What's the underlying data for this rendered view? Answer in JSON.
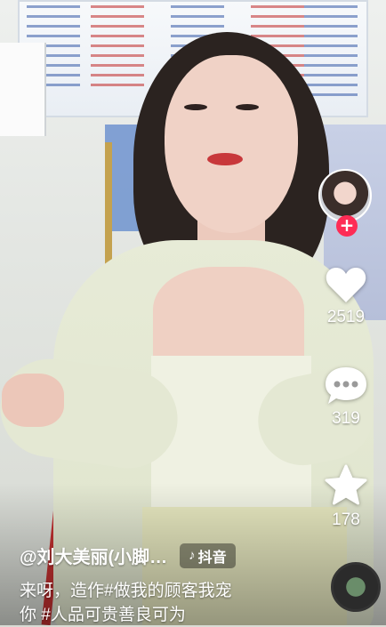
{
  "author": {
    "handle": "@刘大美丽(小脚…"
  },
  "app_badge": {
    "label": "抖音",
    "icon": "music-note-icon"
  },
  "caption": {
    "line1": "来呀，造作#做我的顾客我宠",
    "line2": "你 #人品可贵善良可为"
  },
  "actions": {
    "follow": {
      "symbol": "+",
      "color": "#fe2c55"
    },
    "like": {
      "count": "2519",
      "icon": "heart-icon"
    },
    "comment": {
      "count": "319",
      "icon": "comment-icon"
    },
    "favorite": {
      "count": "178",
      "icon": "star-icon"
    }
  },
  "music": {
    "icon": "music-disc-icon"
  }
}
